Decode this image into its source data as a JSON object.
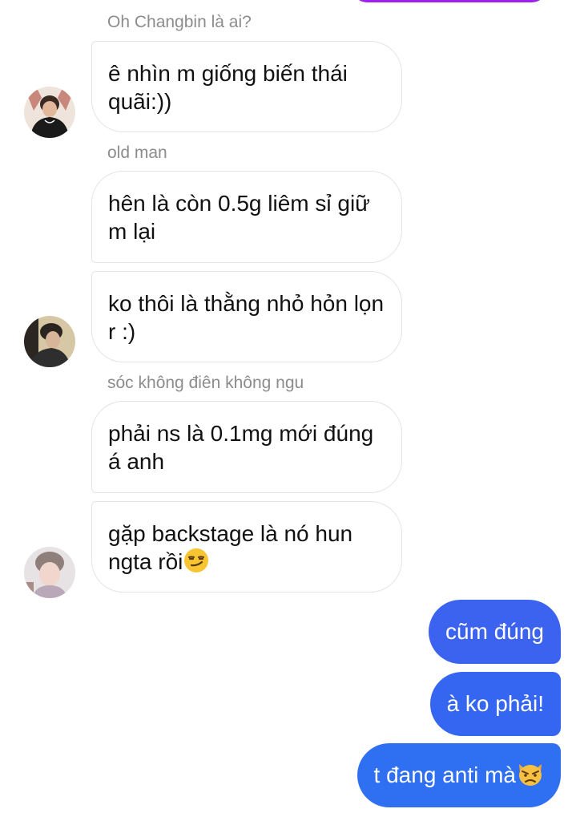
{
  "chat": {
    "groups": [
      {
        "sender": "Oh Changbin là ai?",
        "messages": [
          "ê nhìn m giống biến thái quãi:))"
        ]
      },
      {
        "sender": "old man",
        "messages": [
          "hên là còn 0.5g liêm sỉ giữ m lại",
          "ko thôi là thằng nhỏ hỏn lọn r :)"
        ]
      },
      {
        "sender": "sóc không điên không ngu",
        "messages": [
          "phải ns là 0.1mg mới đúng á anh",
          "gặp backstage là nó hun ngta rồi"
        ]
      }
    ],
    "outgoing": [
      "cũm đúng",
      "à ko phải!",
      "t đang anti mà"
    ],
    "emoji": {
      "smirk": "smirking-face-emoji",
      "angry_cat": "pouting-cat-emoji"
    }
  },
  "colors": {
    "outgoing_bubble": "#3b63f0",
    "outgoing_bubble_alt": "#2f6ff2",
    "incoming_border": "#e4e4e4",
    "sender_name": "#8c8c8c",
    "previous_bubble": "#a020f0"
  }
}
